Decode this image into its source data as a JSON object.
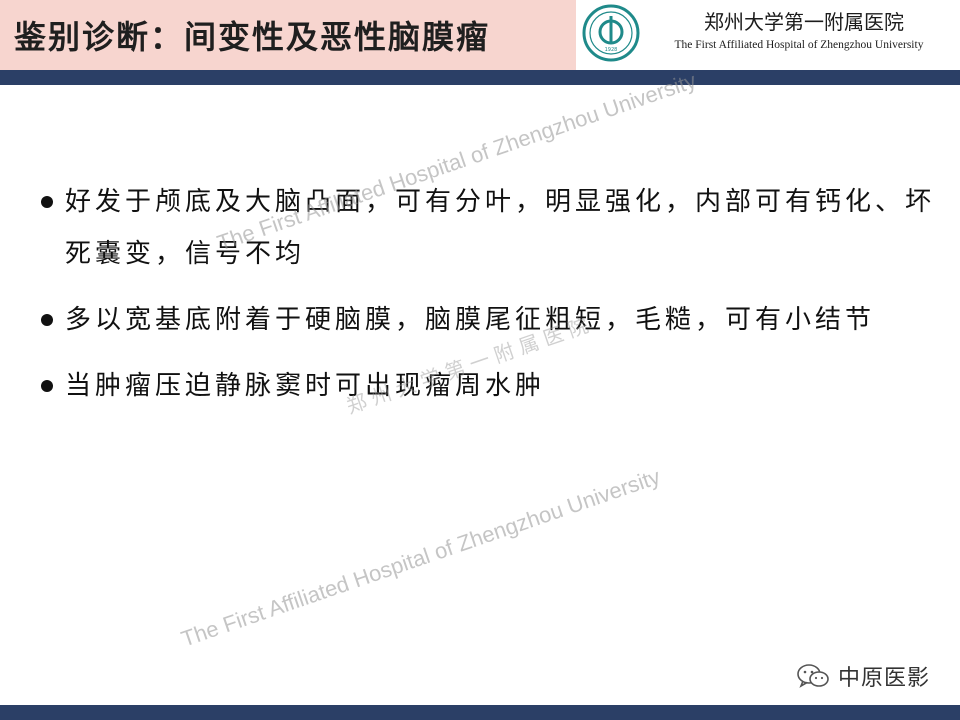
{
  "slide": {
    "title": "鉴别诊断：间变性及恶性脑膜瘤",
    "bullets": [
      "好发于颅底及大脑凸面，可有分叶，明显强化，内部可有钙化、坏死囊变，信号不均",
      "多以宽基底附着于硬脑膜，脑膜尾征粗短，毛糙，可有小结节",
      "当肿瘤压迫静脉窦时可出现瘤周水肿"
    ]
  },
  "logo": {
    "hospital_cn": "郑州大学第一附属医院",
    "hospital_en": "The First Affiliated Hospital of Zhengzhou University",
    "seal_year": "1928"
  },
  "watermarks": {
    "en_upper": "The First Affiliated Hospital of Zhengzhou University",
    "en_lower": "The First Affiliated Hospital of Zhengzhou University",
    "cn": "郑州大学第一附属医院"
  },
  "source": {
    "label": "中原医影",
    "icon": "wechat-icon"
  },
  "colors": {
    "title_bg": "#f7d5cf",
    "bar": "#2b3f66",
    "seal": "#1f8a8a"
  }
}
